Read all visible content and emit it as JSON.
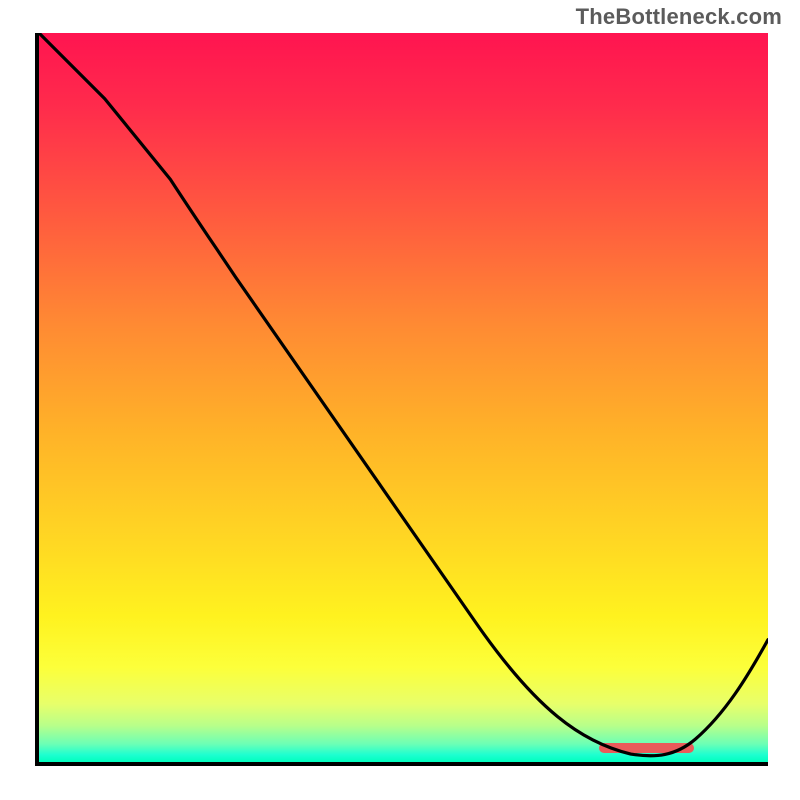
{
  "watermark": "TheBottleneck.com",
  "colors": {
    "marker": "#ea5a5a",
    "axis": "#000000"
  },
  "chart_data": {
    "type": "line",
    "title": "",
    "xlabel": "",
    "ylabel": "",
    "xlim": [
      0,
      100
    ],
    "ylim": [
      0,
      100
    ],
    "grid": false,
    "legend": false,
    "background_gradient": [
      "#ff1450",
      "#ffd823",
      "#fff21f",
      "#00ffbe"
    ],
    "series": [
      {
        "name": "curve",
        "x": [
          0,
          9,
          18,
          24,
          30,
          40,
          50,
          60,
          70,
          77,
          82,
          86,
          90,
          94,
          100
        ],
        "values": [
          100,
          91,
          80,
          71,
          63,
          49,
          37,
          25,
          13,
          4,
          1,
          0,
          2,
          7,
          17
        ],
        "note": "y ≈ relative height (0 = bottom axis, 100 = top). The curve descends from top-left, kinks around x≈24, reaches a minimum near x≈86, then rises toward the right edge."
      }
    ],
    "annotations": [
      {
        "type": "marker-bar",
        "x_range": [
          76,
          89
        ],
        "y": 1,
        "color": "#ea5a5a"
      }
    ]
  }
}
